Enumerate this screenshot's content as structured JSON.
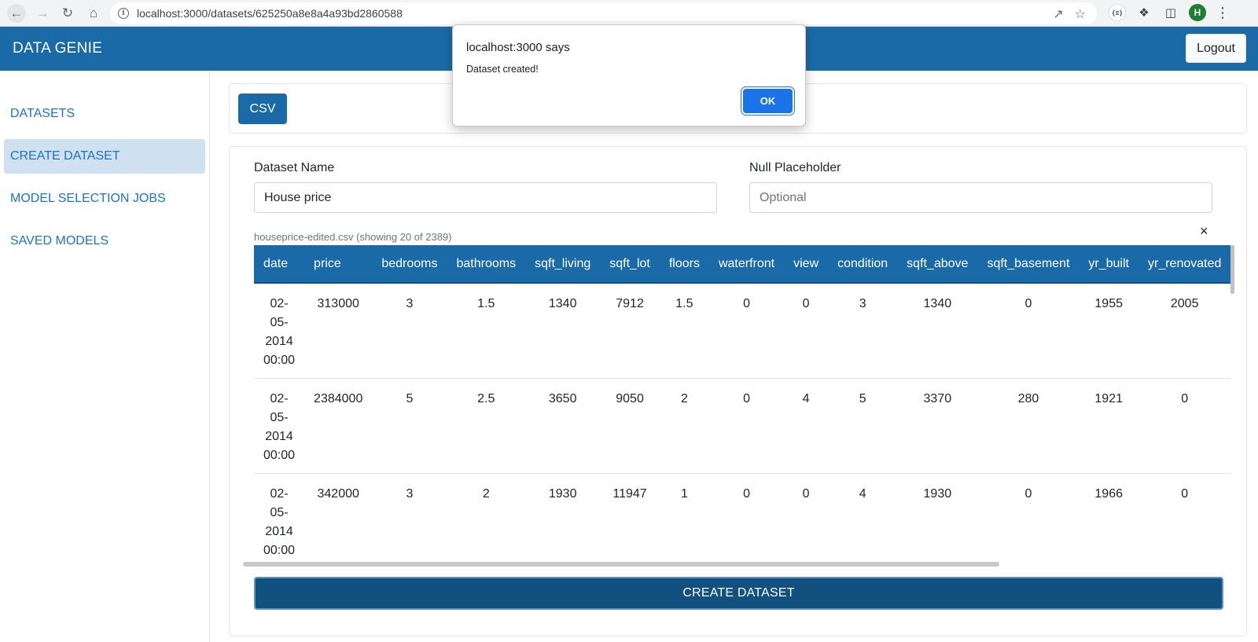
{
  "browser": {
    "url": "localhost:3000/datasets/625250a8e8a4a93bd2860588",
    "profile_initial": "H",
    "json_ext_label": "{≡}"
  },
  "app": {
    "brand": "DATA GENIE",
    "logout_label": "Logout"
  },
  "sidebar": {
    "items": [
      {
        "label": "DATASETS"
      },
      {
        "label": "CREATE DATASET"
      },
      {
        "label": "MODEL SELECTION JOBS"
      },
      {
        "label": "SAVED MODELS"
      }
    ]
  },
  "toolbar": {
    "csv_label": "CSV"
  },
  "form": {
    "dataset_name_label": "Dataset Name",
    "dataset_name_value": "House price",
    "null_placeholder_label": "Null Placeholder",
    "null_placeholder_placeholder": "Optional",
    "file_info": "houseprice-edited.csv (showing 20 of 2389)",
    "close_symbol": "×",
    "create_label": "CREATE DATASET"
  },
  "table": {
    "columns": [
      "date",
      "price",
      "bedrooms",
      "bathrooms",
      "sqft_living",
      "sqft_lot",
      "floors",
      "waterfront",
      "view",
      "condition",
      "sqft_above",
      "sqft_basement",
      "yr_built",
      "yr_renovated"
    ],
    "rows": [
      {
        "date": [
          "02-",
          "05-",
          "2014",
          "00:00"
        ],
        "cells": [
          "313000",
          "3",
          "1.5",
          "1340",
          "7912",
          "1.5",
          "0",
          "0",
          "3",
          "1340",
          "0",
          "1955",
          "2005"
        ]
      },
      {
        "date": [
          "02-",
          "05-",
          "2014",
          "00:00"
        ],
        "cells": [
          "2384000",
          "5",
          "2.5",
          "3650",
          "9050",
          "2",
          "0",
          "4",
          "5",
          "3370",
          "280",
          "1921",
          "0"
        ]
      },
      {
        "date": [
          "02-",
          "05-",
          "2014",
          "00:00"
        ],
        "cells": [
          "342000",
          "3",
          "2",
          "1930",
          "11947",
          "1",
          "0",
          "0",
          "4",
          "1930",
          "0",
          "1966",
          "0"
        ]
      }
    ]
  },
  "dialog": {
    "title": "localhost:3000 says",
    "message": "Dataset created!",
    "ok_label": "OK"
  }
}
